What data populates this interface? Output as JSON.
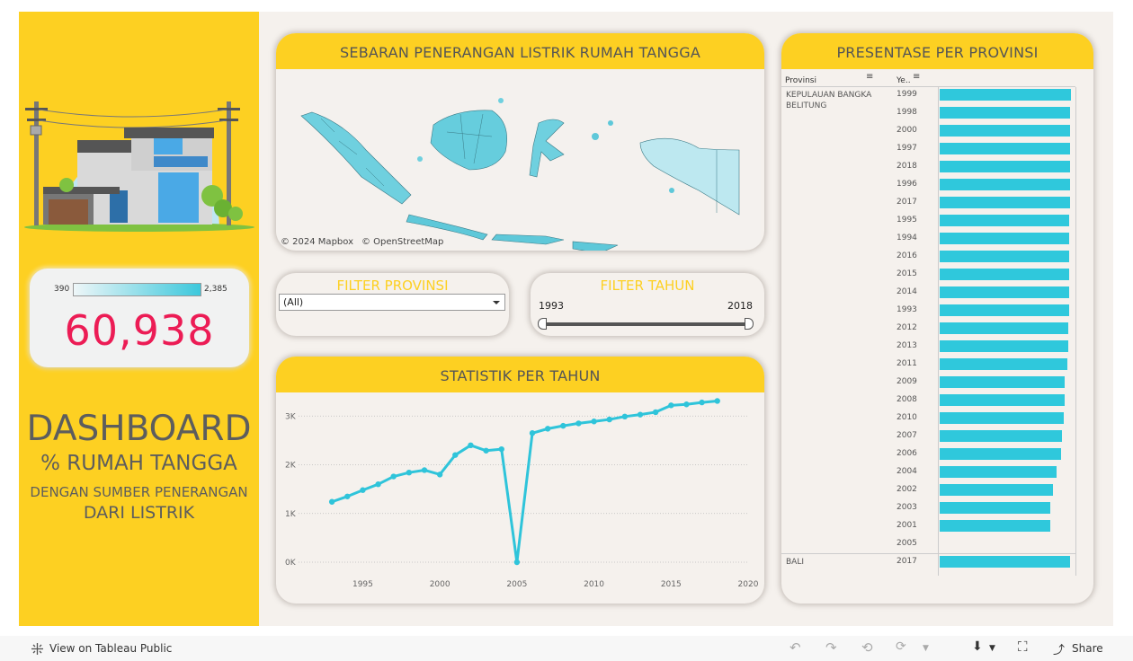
{
  "dashboard": {
    "title_main": "DASHBOARD",
    "title_sub1": "% RUMAH TANGGA",
    "title_sub2": "DENGAN SUMBER PENERANGAN",
    "title_sub3": "DARI LISTRIK"
  },
  "kpi": {
    "legend_min": "390",
    "legend_max": "2,385",
    "value": "60,938",
    "value_color": "#ec1c55"
  },
  "map_card": {
    "title": "SEBARAN PENERANGAN LISTRIK RUMAH TANGGA",
    "attribution_mapbox": "© 2024 Mapbox",
    "attribution_osm": "© OpenStreetMap"
  },
  "filter_provinsi": {
    "title": "FILTER PROVINSI",
    "selected": "(All)"
  },
  "filter_tahun": {
    "title": "FILTER TAHUN",
    "min": "1993",
    "max": "2018"
  },
  "stat_card": {
    "title": "STATISTIK PER TAHUN"
  },
  "chart_data": {
    "type": "line",
    "title": "STATISTIK PER TAHUN",
    "xlabel": "",
    "ylabel": "",
    "x_ticks": [
      "1995",
      "2000",
      "2005",
      "2010",
      "2015",
      "2020"
    ],
    "y_ticks": [
      "0K",
      "1K",
      "2K",
      "3K"
    ],
    "ylim": [
      0,
      3300
    ],
    "xlim": [
      1992,
      2020
    ],
    "grid": "horizontal-dotted",
    "color": "#2fc4da",
    "x": [
      1993,
      1994,
      1995,
      1996,
      1997,
      1998,
      1999,
      2000,
      2001,
      2002,
      2003,
      2004,
      2005,
      2006,
      2007,
      2008,
      2009,
      2010,
      2011,
      2012,
      2013,
      2014,
      2015,
      2016,
      2017,
      2018
    ],
    "values": [
      1240,
      1350,
      1480,
      1600,
      1760,
      1840,
      1890,
      1800,
      2200,
      2400,
      2290,
      2320,
      0,
      2650,
      2740,
      2800,
      2850,
      2890,
      2930,
      2990,
      3030,
      3080,
      3220,
      3240,
      3280,
      3310
    ]
  },
  "presentase": {
    "title": "PRESENTASE PER PROVINSI",
    "col_provinsi": "Provinsi",
    "col_year": "Ye..",
    "provinces": [
      {
        "name": "KEPULAUAN BANGKA BELITUNG",
        "rows": [
          {
            "year": "1999",
            "value": 0.985
          },
          {
            "year": "1998",
            "value": 0.98
          },
          {
            "year": "2000",
            "value": 0.98
          },
          {
            "year": "1997",
            "value": 0.98
          },
          {
            "year": "2018",
            "value": 0.98
          },
          {
            "year": "1996",
            "value": 0.98
          },
          {
            "year": "2017",
            "value": 0.98
          },
          {
            "year": "1995",
            "value": 0.975
          },
          {
            "year": "1994",
            "value": 0.975
          },
          {
            "year": "2016",
            "value": 0.975
          },
          {
            "year": "2015",
            "value": 0.975
          },
          {
            "year": "2014",
            "value": 0.97
          },
          {
            "year": "1993",
            "value": 0.97
          },
          {
            "year": "2012",
            "value": 0.965
          },
          {
            "year": "2013",
            "value": 0.965
          },
          {
            "year": "2011",
            "value": 0.96
          },
          {
            "year": "2009",
            "value": 0.94
          },
          {
            "year": "2008",
            "value": 0.94
          },
          {
            "year": "2010",
            "value": 0.93
          },
          {
            "year": "2007",
            "value": 0.92
          },
          {
            "year": "2006",
            "value": 0.91
          },
          {
            "year": "2004",
            "value": 0.88
          },
          {
            "year": "2002",
            "value": 0.85
          },
          {
            "year": "2003",
            "value": 0.83
          },
          {
            "year": "2001",
            "value": 0.83
          },
          {
            "year": "2005",
            "value": 0
          }
        ]
      },
      {
        "name": "BALI",
        "rows": [
          {
            "year": "2017",
            "value": 0.98
          }
        ]
      }
    ]
  },
  "toolbar": {
    "view_label": "View on Tableau Public",
    "share_label": "Share"
  }
}
